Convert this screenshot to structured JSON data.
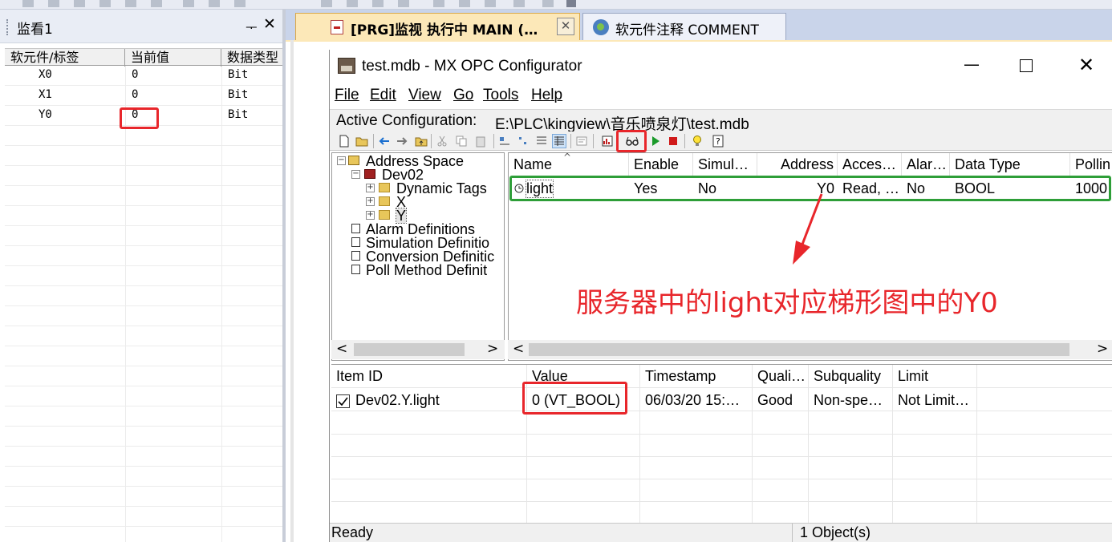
{
  "monitor": {
    "title": "监看1",
    "pin_glyph": "ᅮ",
    "close_glyph": "✕",
    "columns": [
      "软元件/标签",
      "当前值",
      "数据类型"
    ],
    "rows": [
      {
        "device": "X0",
        "value": "0",
        "type": "Bit"
      },
      {
        "device": "X1",
        "value": "0",
        "type": "Bit"
      },
      {
        "device": "Y0",
        "value": "0",
        "type": "Bit"
      }
    ]
  },
  "tabs": [
    {
      "label": "[PRG]监视 执行中 MAIN (…",
      "close": "✕"
    },
    {
      "label": "软元件注释 COMMENT"
    }
  ],
  "opc": {
    "title": "test.mdb - MX OPC Configurator",
    "controls": {
      "minimize": "—",
      "close": "✕"
    },
    "menu": [
      "File",
      "Edit",
      "View",
      "Go",
      "Tools",
      "Help"
    ],
    "active_config_label": "Active Configuration:",
    "active_config_path": "E:\\PLC\\kingview\\音乐喷泉灯\\test.mdb",
    "tree": {
      "root": "Address Space",
      "device": "Dev02",
      "children": [
        "Dynamic Tags",
        "X",
        "Y"
      ],
      "others": [
        "Alarm Definitions",
        "Simulation Definitio",
        "Conversion Definitic",
        "Poll Method Definit"
      ]
    },
    "list": {
      "columns": [
        "Name",
        "Enable",
        "Simul…",
        "Address",
        "Acces…",
        "Alar…",
        "Data Type",
        "Pollin"
      ],
      "row": {
        "name": "light",
        "enable": "Yes",
        "simul": "No",
        "address": "Y0",
        "access": "Read, …",
        "alarm": "No",
        "data_type": "BOOL",
        "polling": "1000"
      }
    },
    "monitor_grid": {
      "columns": [
        "Item ID",
        "Value",
        "Timestamp",
        "Quali…",
        "Subquality",
        "Limit"
      ],
      "row": {
        "item_id": "Dev02.Y.light",
        "value": "0 (VT_BOOL)",
        "timestamp": "06/03/20 15:…",
        "quality": "Good",
        "subquality": "Non-spe…",
        "limit": "Not Limit…",
        "checked": true
      }
    },
    "status": {
      "left": "Ready",
      "right": "1 Object(s)"
    },
    "scroll": {
      "left_arrow": "<",
      "right_arrow": ">"
    }
  },
  "annotation": {
    "text": "服务器中的light对应梯形图中的Y0",
    "color": "#e8262b",
    "highlight_green": "#2e9e38"
  }
}
